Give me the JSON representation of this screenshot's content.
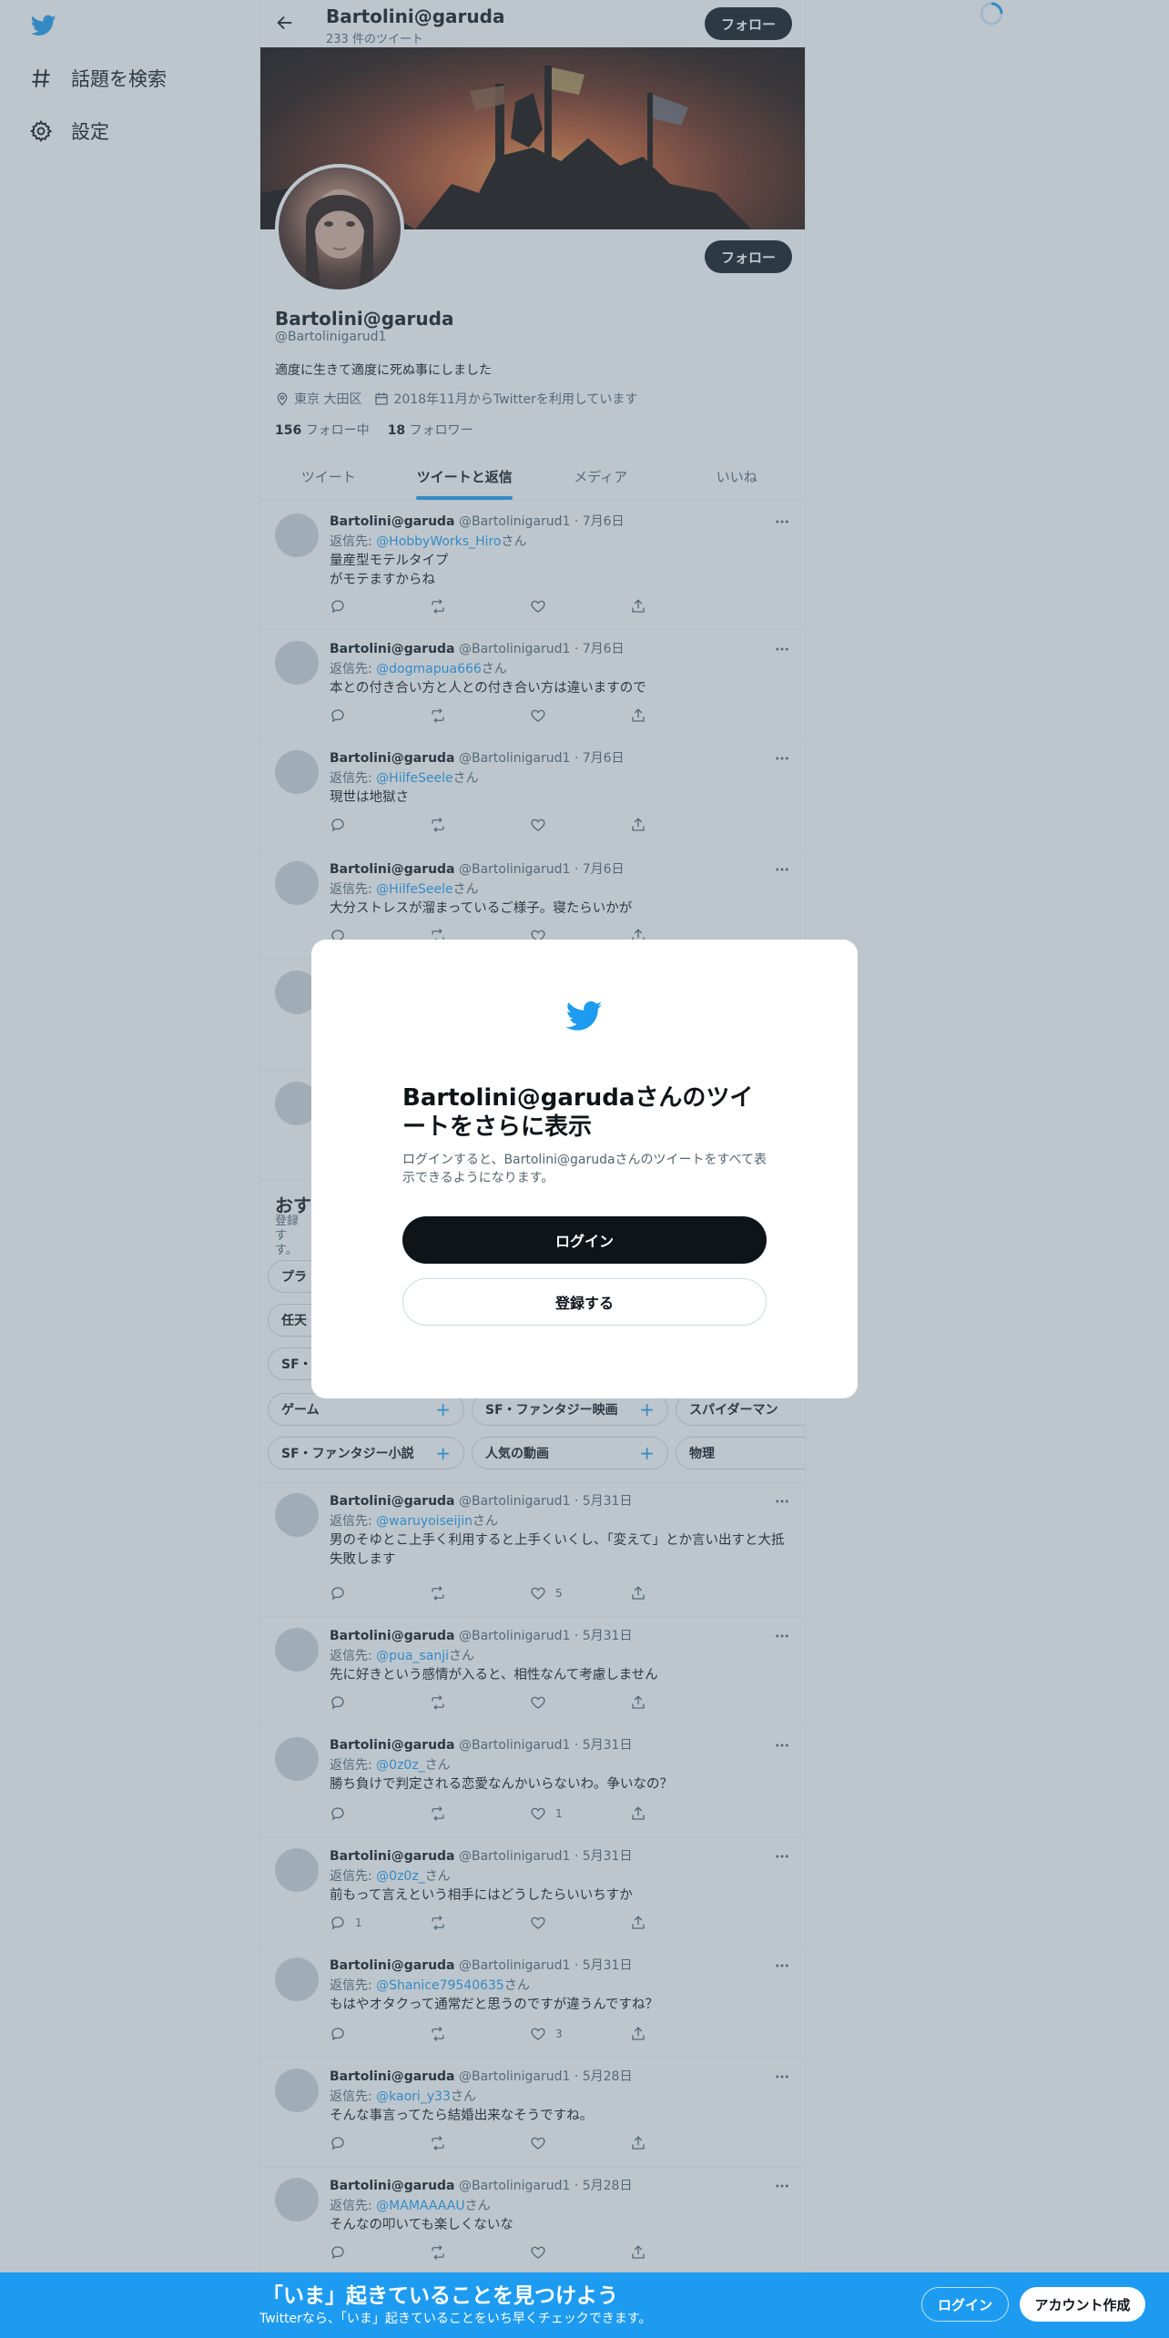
{
  "colors": {
    "accent": "#1d9bf0",
    "text": "#0f1419",
    "muted": "#536471",
    "dark_button": "#0f1419",
    "overlay": "rgba(91,112,131,0.40)"
  },
  "nav": {
    "items": [
      {
        "label": "話題を検索",
        "icon": "hashtag-icon"
      },
      {
        "label": "設定",
        "icon": "gear-icon"
      }
    ]
  },
  "header": {
    "name": "Bartolini@garuda",
    "tweet_count": "233 件のツイート",
    "follow_label": "フォロー"
  },
  "profile": {
    "name": "Bartolini@garuda",
    "handle": "@Bartolinigarud1",
    "bio": "適度に生きて適度に死ぬ事にしました",
    "location": "東京 大田区",
    "joined": "2018年11月からTwitterを利用しています",
    "following_count": "156",
    "following_label": "フォロー中",
    "followers_count": "18",
    "followers_label": "フォロワー",
    "follow_label": "フォロー"
  },
  "tabs": [
    {
      "label": "ツイート"
    },
    {
      "label": "ツイートと返信",
      "active": true
    },
    {
      "label": "メディア"
    },
    {
      "label": "いいね"
    }
  ],
  "tweets_top": [
    {
      "name": "Bartolini@garuda",
      "meta": "@Bartolinigarud1 · 7月6日",
      "reply_prefix": "返信先: ",
      "mention": "@HobbyWorks_Hiro",
      "reply_suffix": "さん",
      "text": "量産型モテルタイプ\nがモテますからね",
      "likes": "",
      "replies": ""
    },
    {
      "name": "Bartolini@garuda",
      "meta": "@Bartolinigarud1 · 7月6日",
      "reply_prefix": "返信先: ",
      "mention": "@dogmapua666",
      "reply_suffix": "さん",
      "text": "本との付き合い方と人との付き合い方は違いますので",
      "likes": "",
      "replies": ""
    },
    {
      "name": "Bartolini@garuda",
      "meta": "@Bartolinigarud1 · 7月6日",
      "reply_prefix": "返信先: ",
      "mention": "@HilfeSeele",
      "reply_suffix": "さん",
      "text": "現世は地獄さ",
      "likes": "",
      "replies": ""
    },
    {
      "name": "Bartolini@garuda",
      "meta": "@Bartolinigarud1 · 7月6日",
      "reply_prefix": "返信先: ",
      "mention": "@HilfeSeele",
      "reply_suffix": "さん",
      "text": "大分ストレスが溜まっているご様子。寝たらいかが",
      "likes": "",
      "replies": ""
    }
  ],
  "topics": {
    "title": "おす",
    "subtitle": "登録す\nす。",
    "row1": [
      {
        "label": "プラ"
      }
    ],
    "row2": [
      {
        "label": "任天"
      }
    ],
    "row3": [
      {
        "label": "SF・"
      }
    ],
    "row4": [
      {
        "label": "ゲーム"
      },
      {
        "label": "SF・ファンタジー映画"
      },
      {
        "label": "スパイダーマン"
      }
    ],
    "row5": [
      {
        "label": "SF・ファンタジー小説"
      },
      {
        "label": "人気の動画"
      },
      {
        "label": "物理"
      }
    ]
  },
  "tweets_bottom": [
    {
      "name": "Bartolini@garuda",
      "meta": "@Bartolinigarud1 · 5月31日",
      "reply_prefix": "返信先: ",
      "mention": "@waruyoiseijin",
      "reply_suffix": "さん",
      "text": "男のそゆとこ上手く利用すると上手くいくし、「変えて」とか言い出すと大抵失敗します",
      "likes": "5",
      "replies": ""
    },
    {
      "name": "Bartolini@garuda",
      "meta": "@Bartolinigarud1 · 5月31日",
      "reply_prefix": "返信先: ",
      "mention": "@pua_sanji",
      "reply_suffix": "さん",
      "text": "先に好きという感情が入ると、相性なんて考慮しません",
      "likes": "",
      "replies": ""
    },
    {
      "name": "Bartolini@garuda",
      "meta": "@Bartolinigarud1 · 5月31日",
      "reply_prefix": "返信先: ",
      "mention": "@0z0z_",
      "reply_suffix": "さん",
      "text": "勝ち負けで判定される恋愛なんかいらないわ。争いなの？",
      "likes": "1",
      "replies": ""
    },
    {
      "name": "Bartolini@garuda",
      "meta": "@Bartolinigarud1 · 5月31日",
      "reply_prefix": "返信先: ",
      "mention": "@0z0z_",
      "reply_suffix": "さん",
      "text": "前もって言えという相手にはどうしたらいいちすか",
      "likes": "",
      "replies": "1"
    },
    {
      "name": "Bartolini@garuda",
      "meta": "@Bartolinigarud1 · 5月31日",
      "reply_prefix": "返信先: ",
      "mention": "@Shanice79540635",
      "reply_suffix": "さん",
      "text": "もはやオタクって通常だと思うのですが違うんですね？",
      "likes": "3",
      "replies": ""
    },
    {
      "name": "Bartolini@garuda",
      "meta": "@Bartolinigarud1 · 5月28日",
      "reply_prefix": "返信先: ",
      "mention": "@kaori_y33",
      "reply_suffix": "さん",
      "text": "そんな事言ってたら結婚出来なそうですね。",
      "likes": "",
      "replies": ""
    },
    {
      "name": "Bartolini@garuda",
      "meta": "@Bartolinigarud1 · 5月28日",
      "reply_prefix": "返信先: ",
      "mention": "@MAMAAAAU",
      "reply_suffix": "さん",
      "text": "そんなの叩いても楽しくないな",
      "likes": "",
      "replies": ""
    }
  ],
  "modal": {
    "title": "Bartolini@garudaさんのツイートをさらに表示",
    "subtitle": "ログインすると、Bartolini@garudaさんのツイートをすべて表示できるようになります。",
    "login_label": "ログイン",
    "signup_label": "登録する"
  },
  "bottom_bar": {
    "title": "「いま」起きていることを見つけよう",
    "subtitle": "Twitterなら、「いま」起きていることをいち早くチェックできます。",
    "login_label": "ログイン",
    "signup_label": "アカウント作成"
  }
}
